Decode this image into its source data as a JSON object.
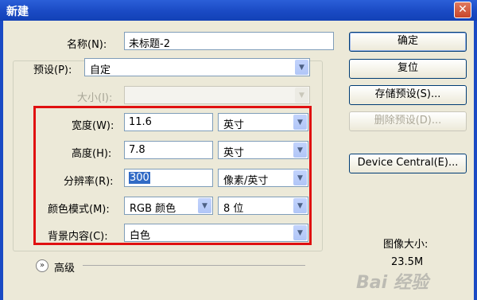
{
  "window": {
    "title": "新建",
    "close_glyph": "✕"
  },
  "form": {
    "name": {
      "label": "名称(N):",
      "value": "未标题-2"
    },
    "preset": {
      "label": "预设(P):",
      "value": "自定"
    },
    "size": {
      "label": "大小(I):",
      "value": ""
    },
    "width": {
      "label": "宽度(W):",
      "value": "11.6",
      "unit": "英寸"
    },
    "height": {
      "label": "高度(H):",
      "value": "7.8",
      "unit": "英寸"
    },
    "resolution": {
      "label": "分辨率(R):",
      "value": "300",
      "unit": "像素/英寸"
    },
    "color_mode": {
      "label": "颜色模式(M):",
      "value": "RGB 颜色",
      "bits": "8 位"
    },
    "background": {
      "label": "背景内容(C):",
      "value": "白色"
    }
  },
  "advanced": {
    "label": "高级",
    "toggle_icon": "double-chevron-down-icon"
  },
  "buttons": {
    "ok": "确定",
    "reset": "复位",
    "save_preset": "存储预设(S)...",
    "delete_preset": "删除预设(D)...",
    "device_central": "Device Central(E)..."
  },
  "image_size": {
    "label": "图像大小:",
    "value": "23.5M"
  },
  "watermark": "Bai 经验",
  "colors": {
    "titlebar": "#1a4ac4",
    "highlight_box": "#e01010",
    "dialog_bg": "#ece9d8"
  }
}
